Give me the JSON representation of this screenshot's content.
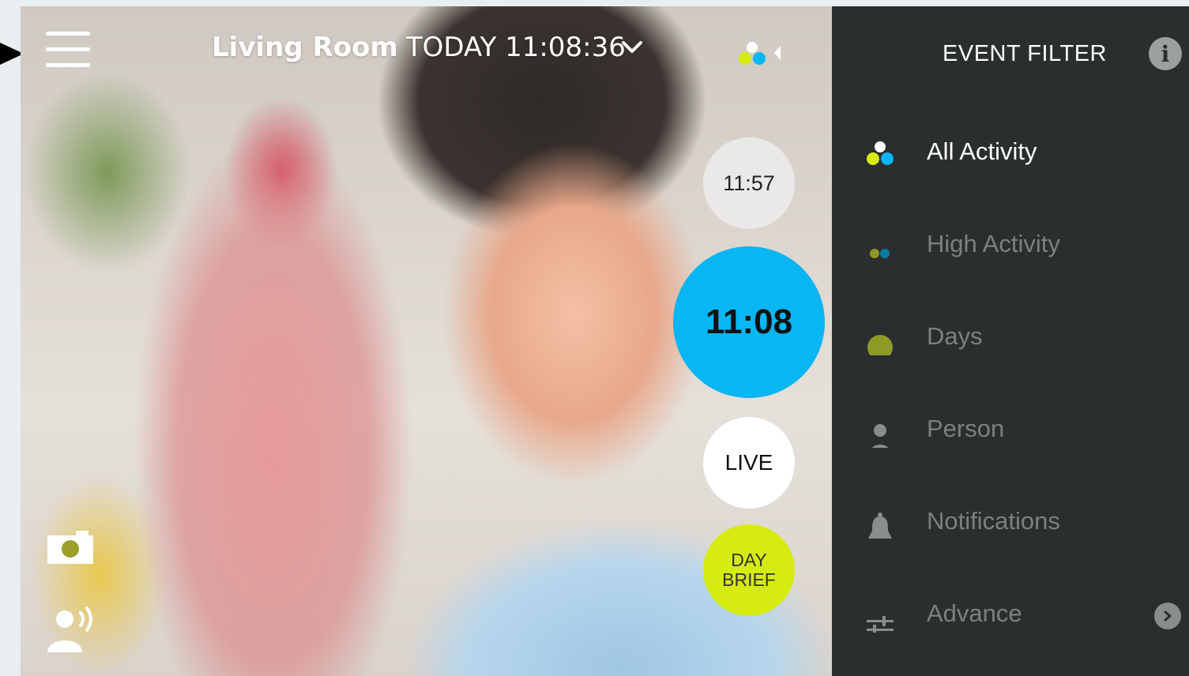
{
  "header": {
    "room": "Living Room",
    "day": "TODAY",
    "time": "11:08:36"
  },
  "timeline": {
    "past_time": "11:57",
    "current_time": "11:08",
    "live_label": "LIVE",
    "brief_label": "DAY\nBRIEF"
  },
  "filter_panel": {
    "title": "EVENT FILTER",
    "items": [
      {
        "label": "All Activity",
        "icon": "activity-dots-icon",
        "active": true
      },
      {
        "label": "High Activity",
        "icon": "high-activity-dots-icon",
        "active": false
      },
      {
        "label": "Days",
        "icon": "days-dot-icon",
        "active": false
      },
      {
        "label": "Person",
        "icon": "person-icon",
        "active": false
      },
      {
        "label": "Notifications",
        "icon": "bell-icon",
        "active": false
      },
      {
        "label": "Advance",
        "icon": "sliders-icon",
        "active": false
      }
    ]
  },
  "colors": {
    "current_bubble": "#07b6f2",
    "brief_bubble": "#d6ec10",
    "panel_bg": "#2b2e2e",
    "active_label": "#ffffff",
    "inactive_label": "#7d8080"
  }
}
